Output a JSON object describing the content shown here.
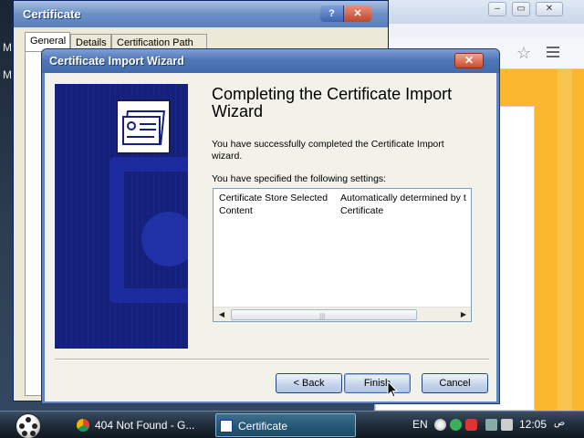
{
  "desktop": {
    "left_letters": [
      "M",
      "M"
    ]
  },
  "browser": {
    "controls": [
      "–",
      "▭",
      "✕"
    ],
    "star_icon": "star-icon",
    "menu_icon": "hamburger-menu-icon"
  },
  "certificate_window": {
    "title": "Certificate",
    "help_label": "?",
    "close_label": "✕",
    "tabs": [
      "General",
      "Details",
      "Certification Path"
    ]
  },
  "wizard": {
    "title": "Certificate Import Wizard",
    "close_label": "✕",
    "heading": "Completing the Certificate Import Wizard",
    "success_text": "You have successfully completed the Certificate Import wizard.",
    "settings_intro": "You have specified the following settings:",
    "settings": [
      {
        "name": "Certificate Store Selected",
        "value": "Automatically determined by t"
      },
      {
        "name": "Content",
        "value": "Certificate"
      }
    ],
    "scroll_left": "◀",
    "scroll_right": "▶",
    "back_label": "< Back",
    "finish_label": "Finish",
    "cancel_label": "Cancel"
  },
  "taskbar": {
    "tasks": [
      {
        "label": "404 Not Found - G...",
        "icon": "chrome-icon",
        "active": false
      },
      {
        "label": "Certificate",
        "icon": "certificate-icon",
        "active": true
      }
    ],
    "language": "EN",
    "clock": "12:05",
    "am_pm": "ص"
  },
  "colors": {
    "wizard_sidebar": "#15207a",
    "browser_page": "#fbb72d",
    "title_close": "#cb4b2c"
  }
}
